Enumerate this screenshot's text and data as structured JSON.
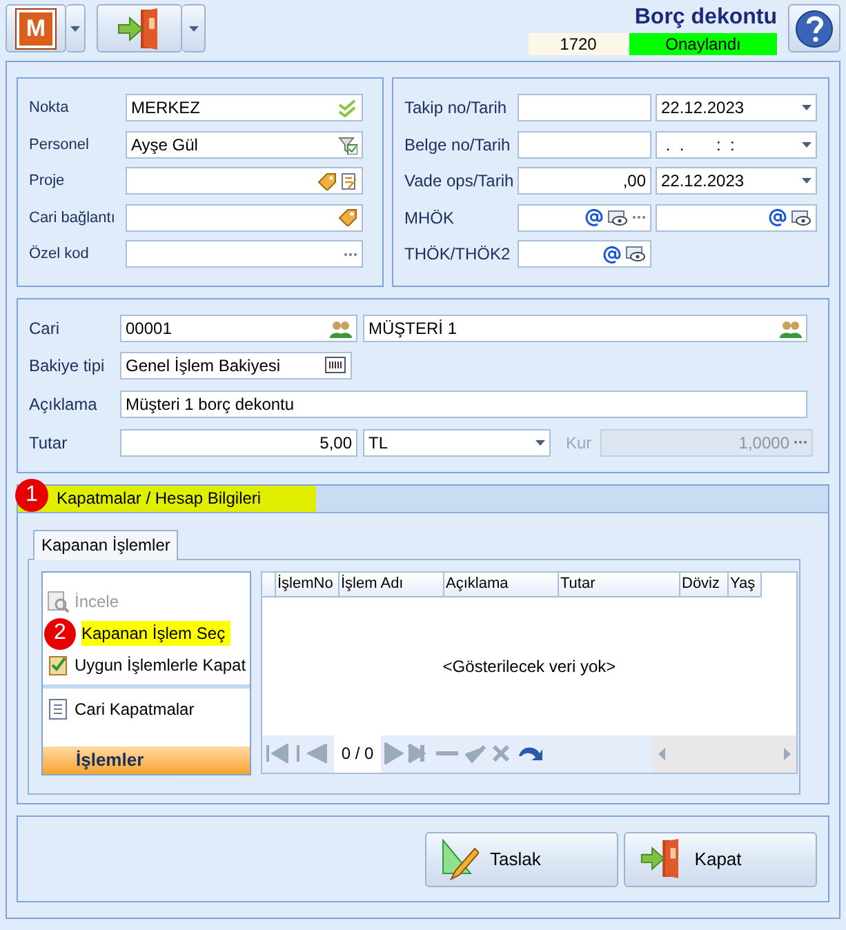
{
  "toolbar": {
    "logo_letter": "M",
    "title": "Borç dekontu",
    "document_no": "1720",
    "status": "Onaylandı"
  },
  "left_fields": [
    {
      "label": "Nokta",
      "value": "MERKEZ"
    },
    {
      "label": "Personel",
      "value": "Ayşe Gül"
    },
    {
      "label": "Proje"
    },
    {
      "label": "Cari bağlantı"
    },
    {
      "label": "Özel kod"
    }
  ],
  "right_fields": [
    {
      "kind": "date",
      "label": "Takip no/Tarih",
      "date": "22.12.2023"
    },
    {
      "kind": "date",
      "label": "Belge no/Tarih",
      "date": " .  .       :  :"
    },
    {
      "kind": "date",
      "label": "Vade ops/Tarih",
      "value": ",00",
      "date": "22.12.2023"
    },
    {
      "kind": "email2",
      "label": "MHÖK"
    },
    {
      "kind": "email",
      "label": "THÖK/THÖK2"
    }
  ],
  "cari": {
    "label": "Cari",
    "code": "00001",
    "name": "MÜŞTERİ 1"
  },
  "bakiye": {
    "label": "Bakiye tipi",
    "value": "Genel İşlem Bakiyesi"
  },
  "aciklama": {
    "label": "Açıklama",
    "value": "Müşteri 1 borç dekontu"
  },
  "tutar": {
    "label": "Tutar",
    "value": "5,00",
    "currency": "TL",
    "rate_label": "Kur",
    "rate": "1,0000",
    "rate_disabled": true
  },
  "section": {
    "title": "Kapatmalar / Hesap Bilgileri",
    "step": "1",
    "highlighted": true
  },
  "tabs": [
    {
      "label": "Kapanan İşlemler",
      "selected": true
    }
  ],
  "action_groups": [
    [
      {
        "kind": "inspect",
        "label": "İncele",
        "disabled": true,
        "highlighted": false
      },
      {
        "label": "Kapanan İşlem Seç",
        "disabled": false,
        "highlighted": true,
        "step": "2"
      },
      {
        "kind": "check",
        "label": "Uygun İşlemlerle Kapat",
        "disabled": false,
        "highlighted": false
      }
    ],
    [
      {
        "kind": "list",
        "label": "Cari Kapatmalar",
        "disabled": false,
        "highlighted": false
      }
    ]
  ],
  "actions_footer": "İşlemler",
  "grid": {
    "columns": [
      "İşlemNo",
      "İşlem Adı",
      "Açıklama",
      "Tutar",
      "Döviz",
      "Yaş"
    ],
    "empty_text": "<Gösterilecek veri yok>",
    "pager": "0 / 0"
  },
  "buttons": [
    {
      "kind": "draft",
      "label": "Taslak"
    },
    {
      "kind": "close",
      "label": "Kapat"
    }
  ]
}
